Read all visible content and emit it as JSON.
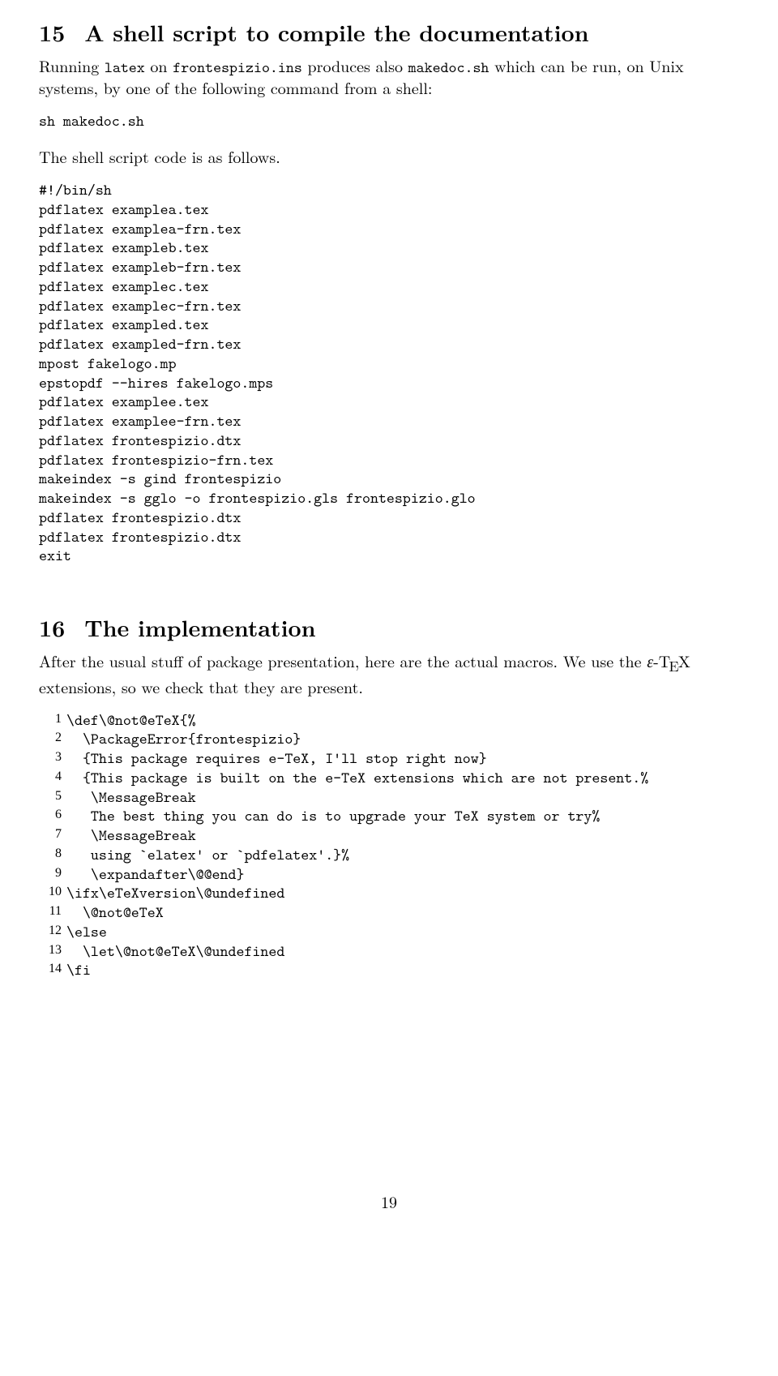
{
  "section15": {
    "number": "15",
    "title": "A shell script to compile the documentation",
    "para1_a": "Running ",
    "para1_t1": "latex",
    "para1_b": " on ",
    "para1_t2": "frontespizio.ins",
    "para1_c": " produces also ",
    "para1_t3": "makedoc.sh",
    "para1_d": " which can be run, on Unix systems, by one of the following command from a shell:",
    "cmd": "sh makedoc.sh",
    "para2": "The shell script code is as follows.",
    "script": "#!/bin/sh\npdflatex examplea.tex\npdflatex examplea-frn.tex\npdflatex exampleb.tex\npdflatex exampleb-frn.tex\npdflatex examplec.tex\npdflatex examplec-frn.tex\npdflatex exampled.tex\npdflatex exampled-frn.tex\nmpost fakelogo.mp\nepstopdf --hires fakelogo.mps\npdflatex examplee.tex\npdflatex examplee-frn.tex\npdflatex frontespizio.dtx\npdflatex frontespizio-frn.tex\nmakeindex -s gind frontespizio\nmakeindex -s gglo -o frontespizio.gls frontespizio.glo\npdflatex frontespizio.dtx\npdflatex frontespizio.dtx\nexit"
  },
  "section16": {
    "number": "16",
    "title": "The implementation",
    "para_a": "After the usual stuff of package presentation, here are the actual macros. We use the ",
    "para_eps": "ε",
    "para_dash": "-",
    "para_t": "T",
    "para_e": "E",
    "para_x": "X",
    "para_b": " extensions, so we check that they are present.",
    "code": [
      {
        "n": "1",
        "c": "\\def\\@not@eTeX{%"
      },
      {
        "n": "2",
        "c": "  \\PackageError{frontespizio}"
      },
      {
        "n": "3",
        "c": "  {This package requires e-TeX, I'll stop right now}"
      },
      {
        "n": "4",
        "c": "  {This package is built on the e-TeX extensions which are not present.%"
      },
      {
        "n": "5",
        "c": "   \\MessageBreak"
      },
      {
        "n": "6",
        "c": "   The best thing you can do is to upgrade your TeX system or try%"
      },
      {
        "n": "7",
        "c": "   \\MessageBreak"
      },
      {
        "n": "8",
        "c": "   using `elatex' or `pdfelatex'.}%"
      },
      {
        "n": "9",
        "c": "   \\expandafter\\@@end}"
      },
      {
        "n": "10",
        "c": "\\ifx\\eTeXversion\\@undefined"
      },
      {
        "n": "11",
        "c": "  \\@not@eTeX"
      },
      {
        "n": "12",
        "c": "\\else"
      },
      {
        "n": "13",
        "c": "  \\let\\@not@eTeX\\@undefined"
      },
      {
        "n": "14",
        "c": "\\fi"
      }
    ]
  },
  "page_number": "19"
}
